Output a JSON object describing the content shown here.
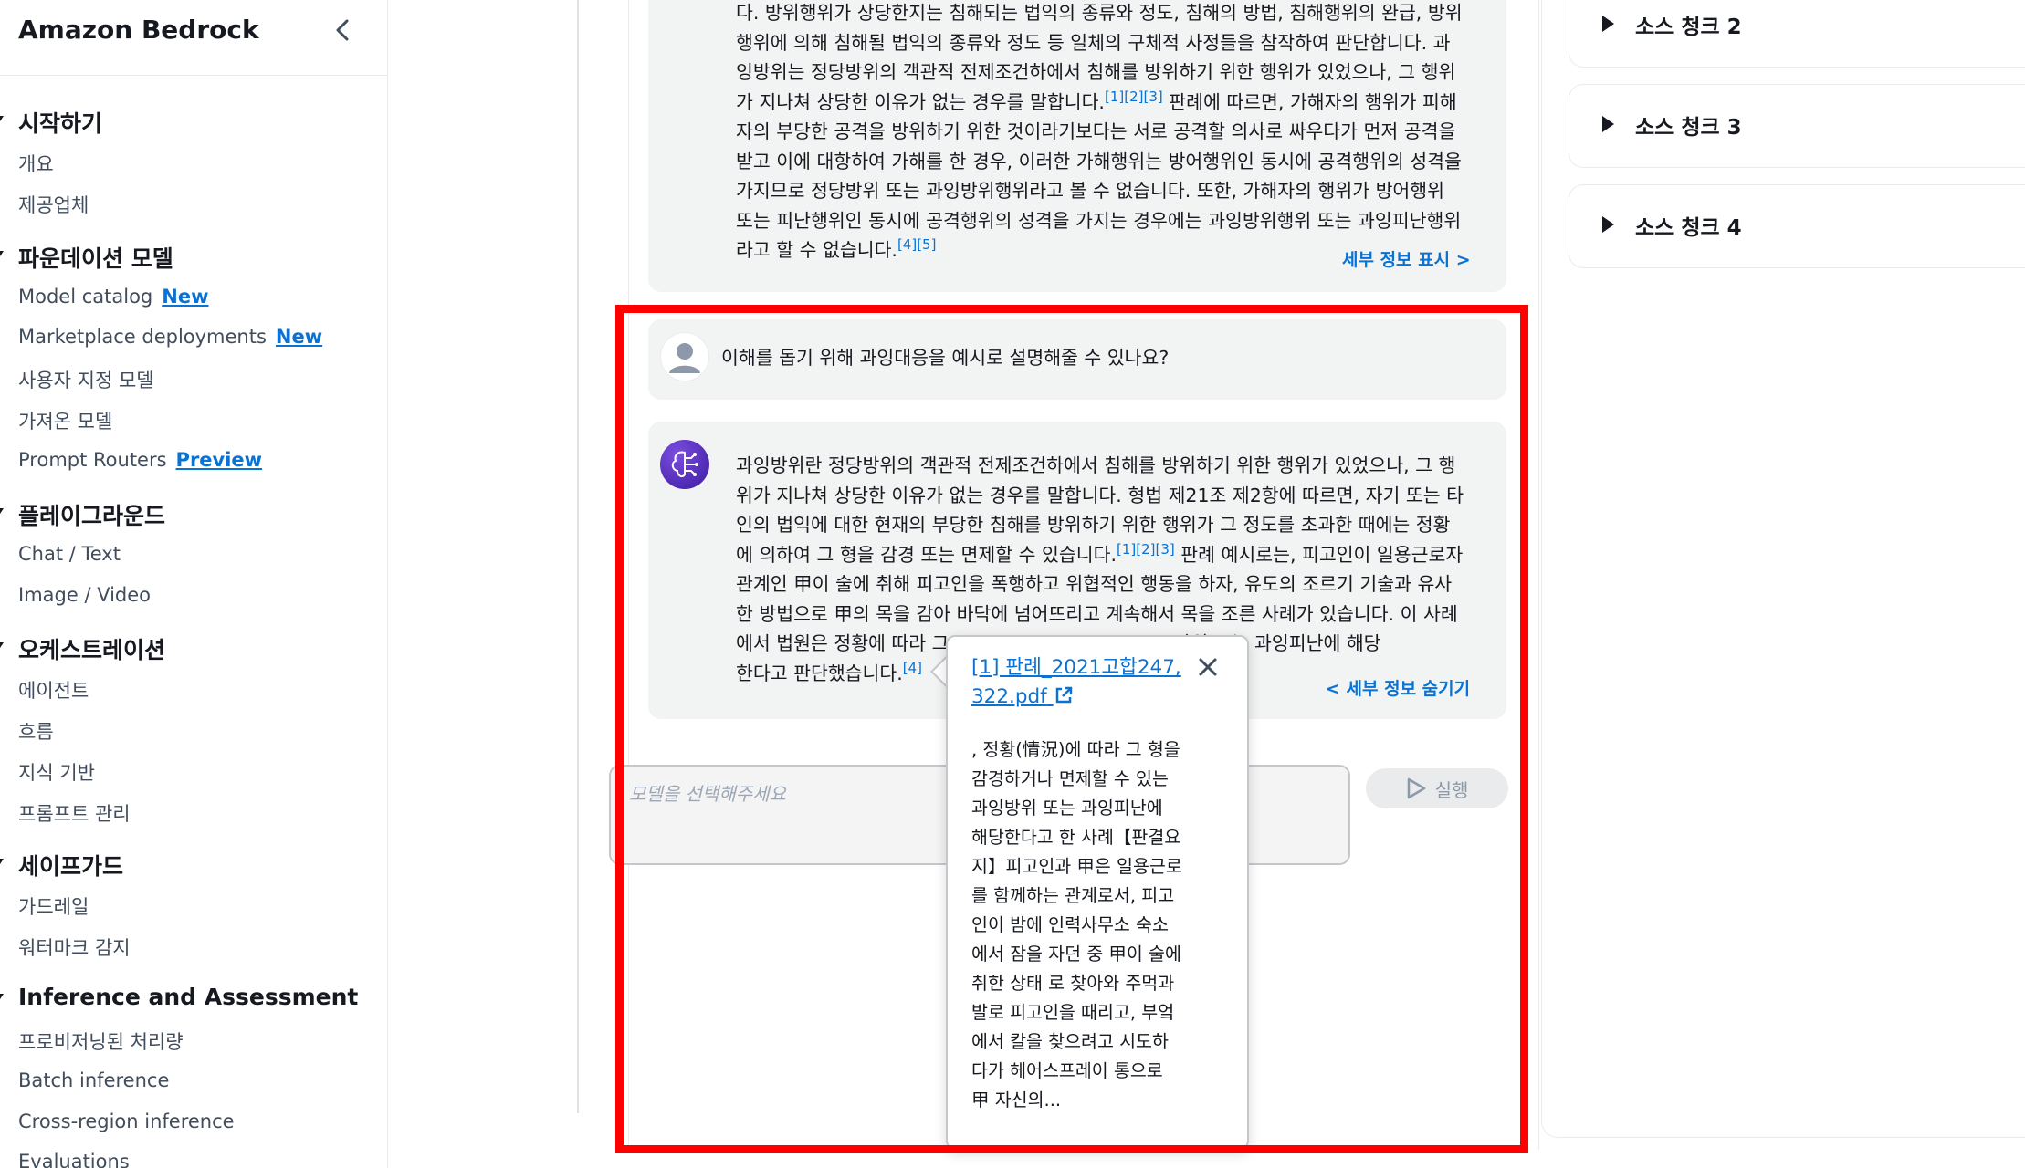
{
  "sidebar": {
    "title": "Amazon Bedrock",
    "sections": [
      {
        "label": "시작하기"
      },
      {
        "label": "파운데이션 모델"
      },
      {
        "label": "플레이그라운드"
      },
      {
        "label": "오케스트레이션"
      },
      {
        "label": "세이프가드"
      },
      {
        "label": "Inference and Assessment"
      }
    ],
    "items": [
      {
        "label": "개요"
      },
      {
        "label": "제공업체"
      },
      {
        "label": "Model catalog",
        "badge": "New"
      },
      {
        "label": "Marketplace deployments",
        "badge": "New"
      },
      {
        "label": "사용자 지정 모델"
      },
      {
        "label": "가져온 모델"
      },
      {
        "label": "Prompt Routers",
        "badge": "Preview"
      },
      {
        "label": "Chat / Text"
      },
      {
        "label": "Image / Video"
      },
      {
        "label": "에이전트"
      },
      {
        "label": "흐름"
      },
      {
        "label": "지식 기반"
      },
      {
        "label": "프롬프트 관리"
      },
      {
        "label": "가드레일"
      },
      {
        "label": "워터마크 감지"
      },
      {
        "label": "프로비저닝된 처리량"
      },
      {
        "label": "Batch inference"
      },
      {
        "label": "Cross-region inference"
      },
      {
        "label": "Evaluations"
      }
    ]
  },
  "chat": {
    "prev_answer": {
      "lines": [
        "다. 방위행위가 상당한지는 침해되는 법익의 종류와 정도, 침해의 방법, 침해행위의 완급, 방위",
        "행위에 의해 침해될 법익의 종류와 정도 등 일체의 구체적 사정들을 참작하여 판단합니다. 과",
        "잉방위는 정당방위의 객관적 전제조건하에서 침해를 방위하기 위한 행위가 있었으나, 그 행위",
        "가 지나쳐 상당한 이유가 없는 경우를 말합니다.",
        "[1][2][3]",
        " 판례에 따르면, 가해자의 행위가 피해",
        "자의 부당한 공격을 방위하기 위한 것이라기보다는 서로 공격할 의사로 싸우다가 먼저 공격을",
        "받고 이에 대항하여 가해를 한 경우, 이러한 가해행위는 방어행위인 동시에 공격행위의 성격을",
        "가지므로 정당방위 또는 과잉방위행위라고 볼 수 없습니다. 또한, 가해자의 행위가 방어행위",
        "또는 피난행위인 동시에 공격행위의 성격을 가지는 경우에는 과잉방위행위 또는 과잉피난행위",
        "라고 할 수 없습니다.",
        "[4][5]"
      ],
      "detail_link": "세부 정보 표시 >"
    },
    "user_question": "이해를 돕기 위해 과잉대응을 예시로 설명해줄 수 있나요?",
    "answer": {
      "lines": [
        "과잉방위란 정당방위의 객관적 전제조건하에서 침해를 방위하기 위한 행위가 있었으나, 그 행",
        "위가 지나쳐 상당한 이유가 없는 경우를 말합니다. 형법 제21조 제2항에 따르면, 자기 또는 타",
        "인의 법익에 대한 현재의 부당한 침해를 방위하기 위한 행위가 그 정도를 초과한 때에는 정황",
        "에 의하여 그 형을 감경 또는 면제할 수 있습니다.",
        "[1][2][3]",
        " 판례 예시로는, 피고인이 일용근로자",
        "관계인 甲이 술에 취해 피고인을 폭행하고 위협적인 행동을 하자, 유도의 조르기 기술과 유사",
        "한 방법으로 甲의 목을 감아 바닥에 넘어뜨리고 계속해서 목을 조른 사례가 있습니다. 이 사례",
        "에서 법원은 정황에 따라 그",
        "방위 또는 과잉피난에 해당",
        "한다고 판단했습니다.",
        "[4]"
      ],
      "detail_link": "< 세부 정보 숨기기"
    },
    "prompt_placeholder": "모델을 선택해주세요",
    "run_label": "실행"
  },
  "popover": {
    "link_text": "[1] 판례_2021고합247, 322.pdf",
    "body_lines": [
      ", 정황(情況)에 따라 그 형을",
      "감경하거나 면제할 수 있는",
      "과잉방위 또는 과잉피난에",
      "해당한다고 한 사례【판결요",
      "지】피고인과 甲은 일용근로",
      "를 함께하는 관계로서, 피고",
      "인이 밤에 인력사무소 숙소",
      "에서 잠을 자던 중 甲이 술에",
      "취한 상태 로 찾아와 주먹과",
      "발로 피고인을 때리고, 부엌",
      "에서 칼을 찾으려고 시도하",
      "다가 헤어스프레이 통으로",
      "甲 자신의..."
    ]
  },
  "right_panel": {
    "chunks": [
      {
        "label": "소스 청크 2"
      },
      {
        "label": "소스 청크 3"
      },
      {
        "label": "소스 청크 4"
      }
    ]
  },
  "colors": {
    "highlight": "#ff0000",
    "link": "#0972d3",
    "card_bg": "#f2f3f3"
  }
}
